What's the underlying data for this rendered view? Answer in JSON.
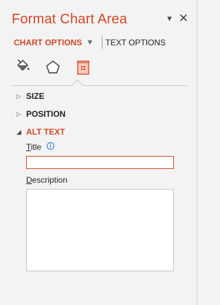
{
  "pane": {
    "title": "Format Chart Area",
    "dropdown_icon": "dropdown-caret-icon",
    "close_icon": "close-icon"
  },
  "tabs": {
    "active": "CHART OPTIONS",
    "inactive": "TEXT OPTIONS"
  },
  "category_icons": [
    "fill-line-icon",
    "effects-pentagon-icon",
    "size-properties-icon"
  ],
  "sections": {
    "size": "SIZE",
    "position": "POSITION",
    "alt_text": "ALT TEXT"
  },
  "alt_text": {
    "title_label_first": "T",
    "title_label_rest": "itle",
    "description_label_first": "D",
    "description_label_rest": "escription",
    "title_value": "",
    "description_value": ""
  },
  "colors": {
    "accent": "#d24726",
    "background": "#f3f3f3"
  }
}
